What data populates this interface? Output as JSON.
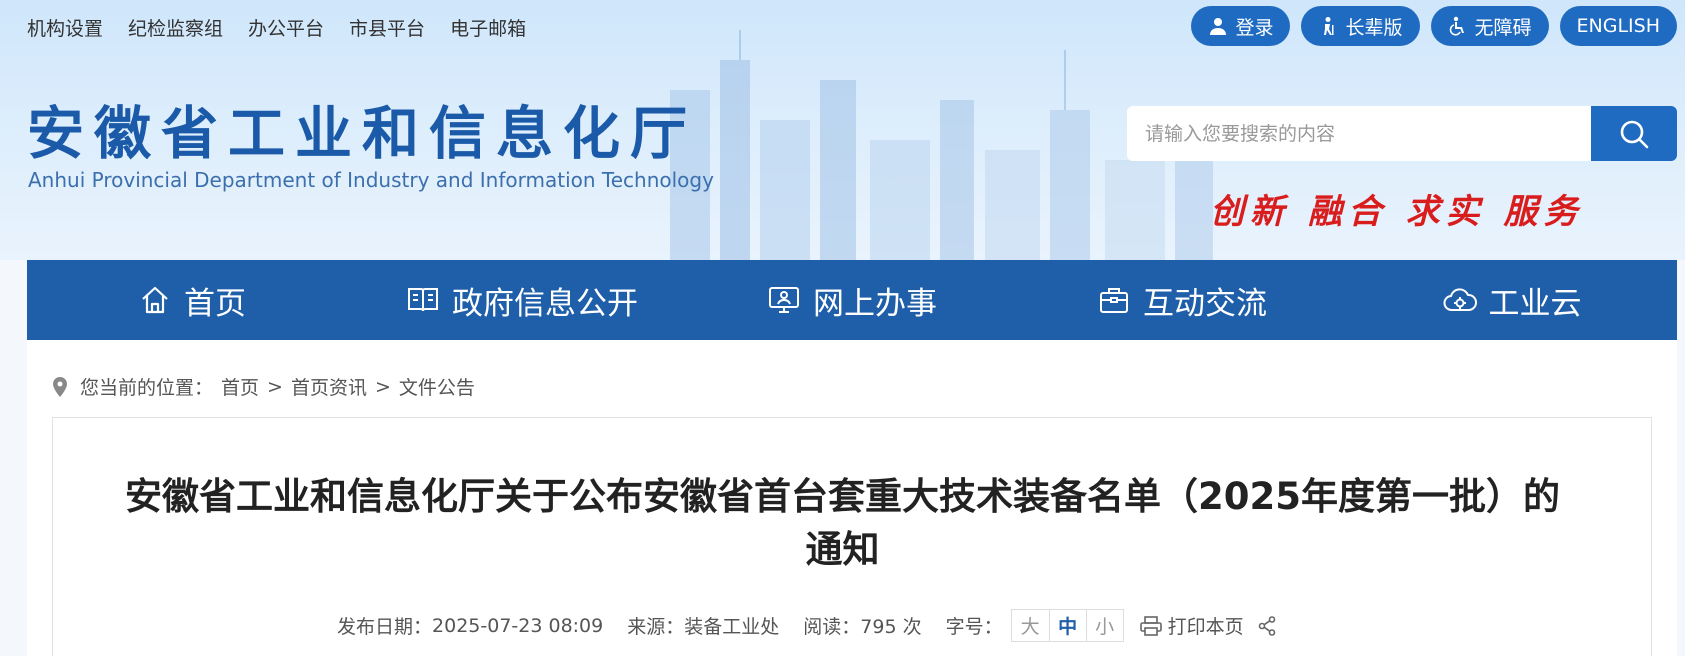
{
  "topnav": [
    "机构设置",
    "纪检监察组",
    "办公平台",
    "市县平台",
    "电子邮箱"
  ],
  "toolbar": {
    "login": "登录",
    "elder": "长辈版",
    "accessible": "无障碍",
    "english": "ENGLISH"
  },
  "logo": {
    "cn": "安徽省工业和信息化厅",
    "en": "Anhui Provincial Department of Industry and Information Technology"
  },
  "search": {
    "placeholder": "请输入您要搜索的内容"
  },
  "slogan": "创新 融合 求实 服务",
  "mainnav": [
    "首页",
    "政府信息公开",
    "网上办事",
    "互动交流",
    "工业云"
  ],
  "breadcrumb": {
    "prefix": "您当前的位置：",
    "items": [
      "首页",
      "首页资讯",
      "文件公告"
    ],
    "sep": ">"
  },
  "article": {
    "title": "安徽省工业和信息化厅关于公布安徽省首台套重大技术装备名单（2025年度第一批）的通知",
    "date_label": "发布日期：",
    "date": "2025-07-23 08:09",
    "source_label": "来源：",
    "source": "装备工业处",
    "views_label": "阅读：",
    "views": "795 次",
    "fontsize_label": "字号：",
    "fontsize_options": [
      "大",
      "中",
      "小"
    ],
    "print": "打印本页"
  },
  "colors": {
    "primary": "#1f5fa9",
    "accent": "#1f6bc1",
    "slogan": "#d91c1c"
  }
}
